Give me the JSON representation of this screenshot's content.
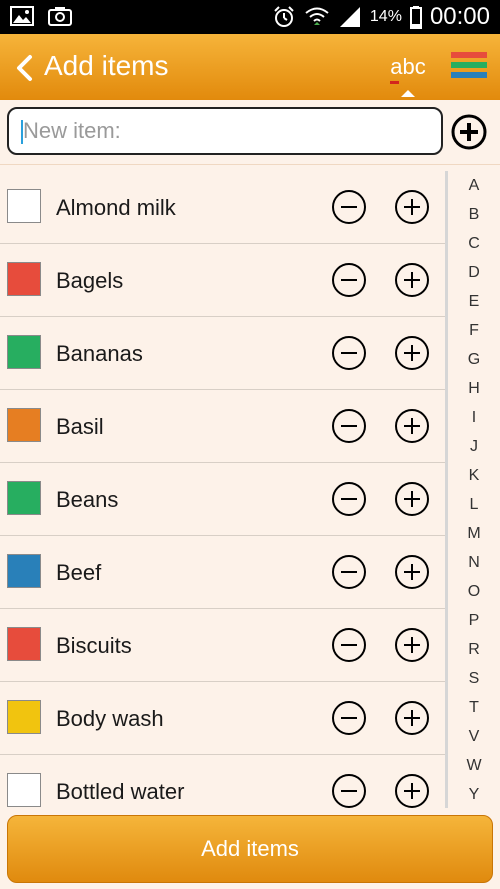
{
  "status_bar": {
    "battery_text": "14%",
    "time": "00:00"
  },
  "header": {
    "title": "Add items",
    "sort_label": "abc"
  },
  "search": {
    "placeholder": "New item:",
    "value": ""
  },
  "items": [
    {
      "name": "Almond milk",
      "color": "#ffffff"
    },
    {
      "name": "Bagels",
      "color": "#e74c3c"
    },
    {
      "name": "Bananas",
      "color": "#27ae60"
    },
    {
      "name": "Basil",
      "color": "#e67e22"
    },
    {
      "name": "Beans",
      "color": "#27ae60"
    },
    {
      "name": "Beef",
      "color": "#2980b9"
    },
    {
      "name": "Biscuits",
      "color": "#e74c3c"
    },
    {
      "name": "Body wash",
      "color": "#f1c40f"
    },
    {
      "name": "Bottled water",
      "color": "#ffffff"
    }
  ],
  "alphabet": [
    "A",
    "B",
    "C",
    "D",
    "E",
    "F",
    "G",
    "H",
    "I",
    "J",
    "K",
    "L",
    "M",
    "N",
    "O",
    "P",
    "R",
    "S",
    "T",
    "V",
    "W",
    "Y"
  ],
  "footer": {
    "add_button_label": "Add items"
  },
  "colors": {
    "accent": "#f0a326",
    "background": "#fdf2e9",
    "list_icon_stripes": [
      "#e74c3c",
      "#27ae60",
      "#f1c40f",
      "#2980b9"
    ]
  }
}
